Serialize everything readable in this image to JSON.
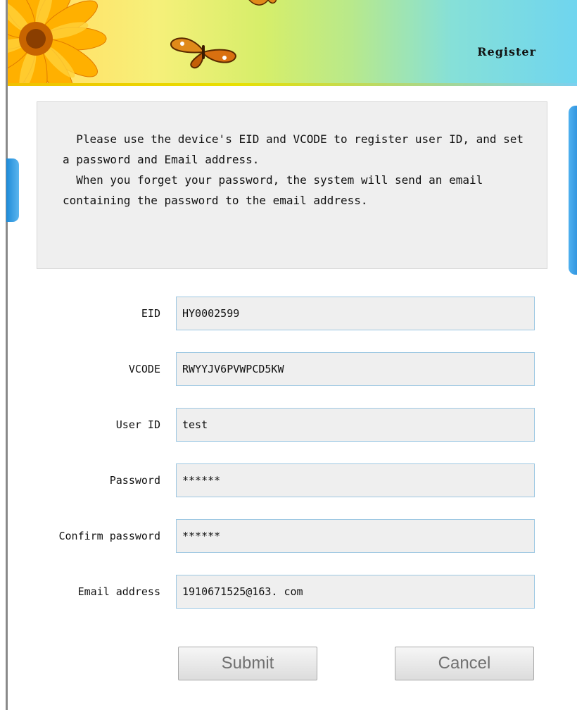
{
  "header": {
    "title": "Register"
  },
  "info": {
    "paragraph1": "  Please use the device's EID and VCODE to register user ID, and set a password and Email address.",
    "paragraph2": "  When you forget your password, the system will send an email containing the password to the email address."
  },
  "form": {
    "fields": [
      {
        "label": "EID",
        "value": "HY0002599"
      },
      {
        "label": "VCODE",
        "value": "RWYYJV6PVWPCD5KW"
      },
      {
        "label": "User ID",
        "value": "test"
      },
      {
        "label": "Password",
        "value": "******"
      },
      {
        "label": "Confirm password",
        "value": "******"
      },
      {
        "label": "Email address",
        "value": "1910671525@163. com"
      }
    ]
  },
  "buttons": {
    "submit": "Submit",
    "cancel": "Cancel"
  },
  "icons": {
    "flower": "sunflower-icon",
    "butterfly": "butterfly-icon"
  },
  "colors": {
    "field_border": "#9cc7e2",
    "tab_blue": "#1f84d6",
    "field_bg": "#efefef"
  }
}
